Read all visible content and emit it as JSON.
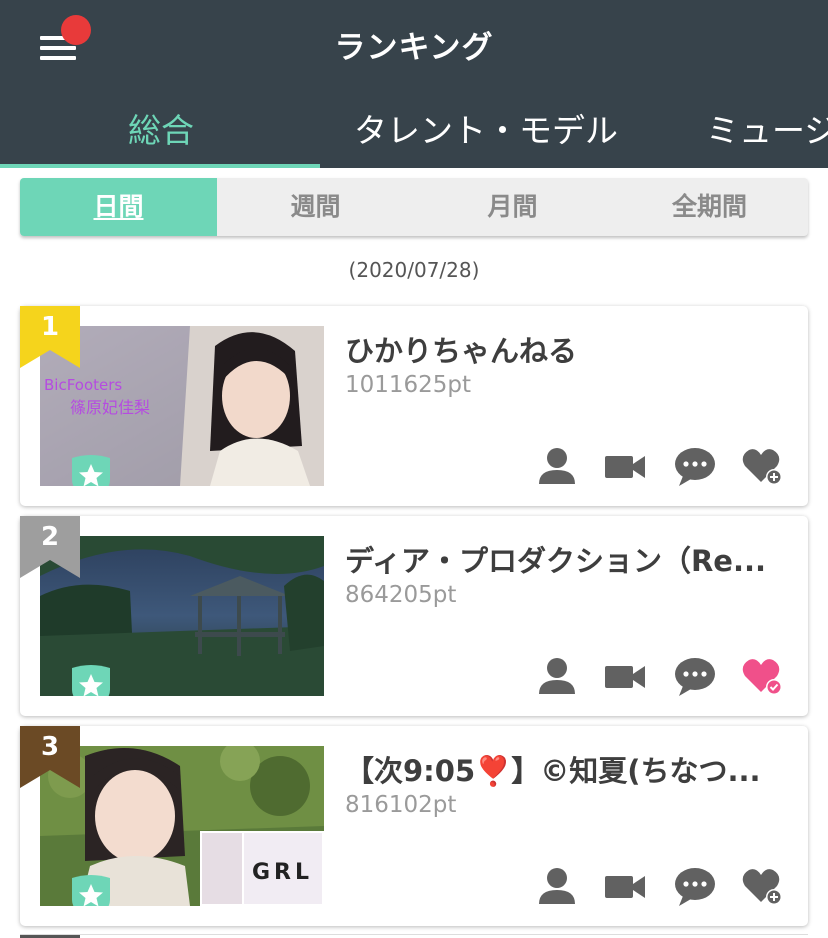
{
  "header": {
    "title": "ランキング",
    "menu_icon": "hamburger-menu-icon",
    "tabs": [
      {
        "label": "総合",
        "active": true
      },
      {
        "label": "タレント・モデル",
        "active": false
      },
      {
        "label": "ミュージ",
        "active": false
      }
    ]
  },
  "period": {
    "items": [
      {
        "label": "日間",
        "active": true
      },
      {
        "label": "週間",
        "active": false
      },
      {
        "label": "月間",
        "active": false
      },
      {
        "label": "全期間",
        "active": false
      }
    ]
  },
  "date_label": "(2020/07/28)",
  "colors": {
    "header_bg": "#37434b",
    "accent": "#6ed6b7",
    "rank1": "#f5d41c",
    "rank2": "#9e9e9e",
    "rank3": "#6b4a25",
    "favorited": "#f0508a"
  },
  "ranking": [
    {
      "rank": "1",
      "name": "ひかりちゃんねる",
      "points": "1011625pt",
      "favorited": false,
      "thumb_text": [
        "BicFooters",
        "篠原妃佳梨"
      ]
    },
    {
      "rank": "2",
      "name": "ディア・プロダクション（Re...",
      "points": "864205pt",
      "favorited": true
    },
    {
      "rank": "3",
      "name": "【次9:05❣️】©知夏(ちなつ...",
      "points": "816102pt",
      "favorited": false,
      "thumb_text": [
        "GRL"
      ]
    }
  ],
  "action_icons": [
    "profile-icon",
    "video-icon",
    "comment-icon",
    "favorite-add-icon"
  ]
}
